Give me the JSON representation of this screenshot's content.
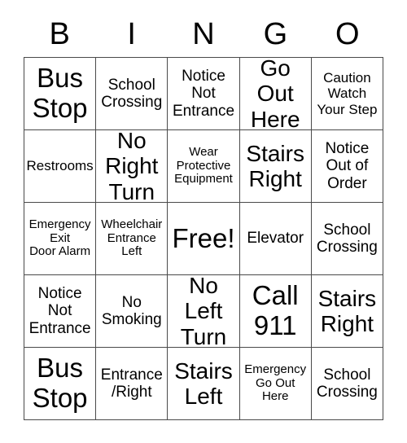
{
  "card": {
    "header_letters": [
      "B",
      "I",
      "N",
      "G",
      "O"
    ],
    "free_space_label": "Free!",
    "rows": [
      [
        {
          "text": "Bus\nStop",
          "size": "xxl"
        },
        {
          "text": "School\nCrossing",
          "size": "md"
        },
        {
          "text": "Notice\nNot\nEntrance",
          "size": "md"
        },
        {
          "text": "Go Out\nHere",
          "size": "xl"
        },
        {
          "text": "Caution\nWatch\nYour Step",
          "size": "sm"
        }
      ],
      [
        {
          "text": "Restrooms",
          "size": "sm"
        },
        {
          "text": "No\nRight\nTurn",
          "size": "xl"
        },
        {
          "text": "Wear\nProtective\nEquipment",
          "size": "xs"
        },
        {
          "text": "Stairs\nRight",
          "size": "xl"
        },
        {
          "text": "Notice\nOut of\nOrder",
          "size": "md"
        }
      ],
      [
        {
          "text": "Emergency\nExit\nDoor Alarm",
          "size": "xs"
        },
        {
          "text": "Wheelchair\nEntrance\nLeft",
          "size": "xs"
        },
        {
          "text": "Free!",
          "size": "free"
        },
        {
          "text": "Elevator",
          "size": "md"
        },
        {
          "text": "School\nCrossing",
          "size": "md"
        }
      ],
      [
        {
          "text": "Notice\nNot\nEntrance",
          "size": "md"
        },
        {
          "text": "No\nSmoking",
          "size": "md"
        },
        {
          "text": "No\nLeft\nTurn",
          "size": "xl"
        },
        {
          "text": "Call\n911",
          "size": "xxl"
        },
        {
          "text": "Stairs\nRight",
          "size": "xl"
        }
      ],
      [
        {
          "text": "Bus\nStop",
          "size": "xxl"
        },
        {
          "text": "Entrance\n/Right",
          "size": "md"
        },
        {
          "text": "Stairs\nLeft",
          "size": "xl"
        },
        {
          "text": "Emergency\nGo Out\nHere",
          "size": "xs"
        },
        {
          "text": "School\nCrossing",
          "size": "md"
        }
      ]
    ]
  },
  "colors": {
    "background": "#ffffff",
    "text": "#000000",
    "grid_line": "#4a4a4a"
  }
}
